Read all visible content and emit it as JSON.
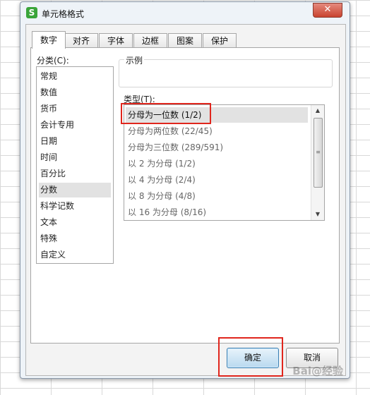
{
  "window": {
    "title": "单元格格式",
    "app_icon": "S",
    "close_symbol": "✕"
  },
  "tabs": [
    {
      "label": "数字",
      "active": true
    },
    {
      "label": "对齐"
    },
    {
      "label": "字体"
    },
    {
      "label": "边框"
    },
    {
      "label": "图案"
    },
    {
      "label": "保护"
    }
  ],
  "category": {
    "label": "分类(C):",
    "items": [
      "常规",
      "数值",
      "货币",
      "会计专用",
      "日期",
      "时间",
      "百分比",
      "分数",
      "科学记数",
      "文本",
      "特殊",
      "自定义"
    ],
    "selected": "分数"
  },
  "sample": {
    "label": "示例"
  },
  "type": {
    "label": "类型(T):",
    "items": [
      "分母为一位数 (1/2)",
      "分母为两位数 (22/45)",
      "分母为三位数 (289/591)",
      "以 2 为分母 (1/2)",
      "以 4 为分母 (2/4)",
      "以 8 为分母 (4/8)",
      "以 16 为分母 (8/16)"
    ],
    "selected": "分母为一位数 (1/2)"
  },
  "buttons": {
    "ok": "确定",
    "cancel": "取消"
  },
  "watermark": "Bai@经验",
  "colors": {
    "highlight": "#e0261d",
    "primary_button": "#b9d9ef"
  }
}
